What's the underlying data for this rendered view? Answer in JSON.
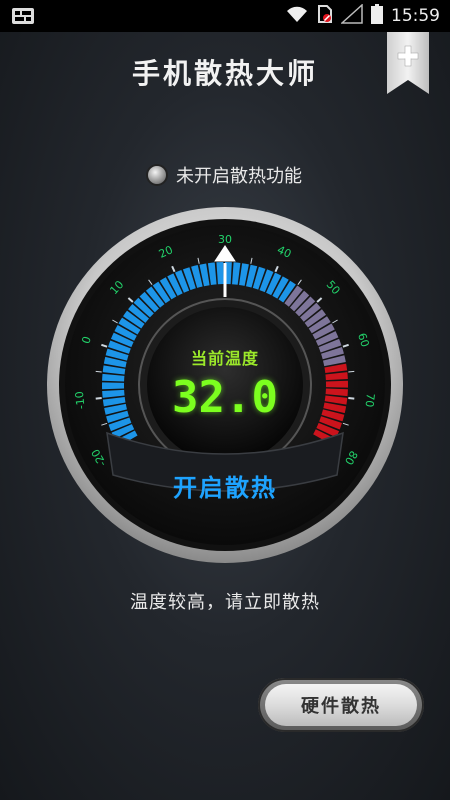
{
  "status_bar": {
    "time": "15:59",
    "icons": [
      "apps-grid-icon",
      "wifi-icon",
      "sim-blocked-icon",
      "signal-icon",
      "battery-icon"
    ]
  },
  "header": {
    "title": "手机散热大师",
    "add_icon": "plus-icon"
  },
  "cooling_status": {
    "text": "未开启散热功能"
  },
  "gauge": {
    "current_label": "当前温度",
    "current_value": "32.0",
    "needle_value": 30,
    "scale_min": -20,
    "scale_max": 80,
    "ticks": [
      "-20",
      "-10",
      "0",
      "10",
      "20",
      "30",
      "40",
      "50",
      "60",
      "70",
      "80"
    ],
    "colors": {
      "cool": "#1ea3ff",
      "warm": "#8a7fa8",
      "hot": "#e0141e",
      "digits": "#7cff1f",
      "ticks": "#22d26a"
    },
    "start_button": "开启散热"
  },
  "hint": "温度较高，请立即散热",
  "hardware_button": "硬件散热"
}
